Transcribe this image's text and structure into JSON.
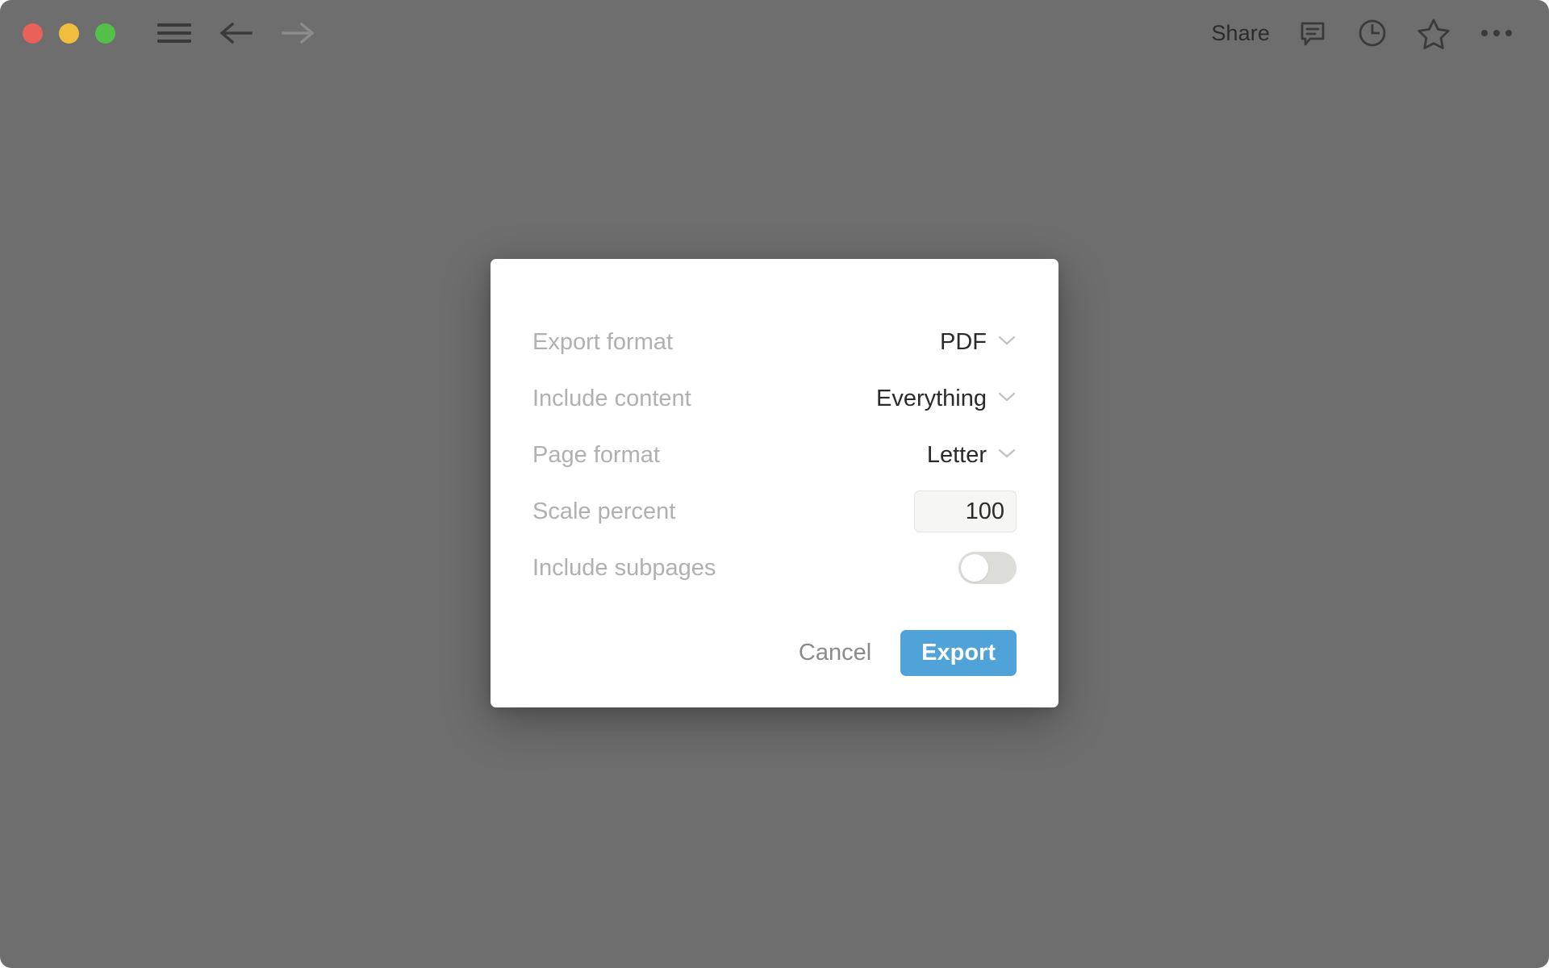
{
  "window": {
    "background_color": "#6e6e6e",
    "corner_radius_px": 14
  },
  "toolbar": {
    "traffic_lights": [
      {
        "name": "close",
        "color": "#ea6159"
      },
      {
        "name": "minimize",
        "color": "#f0bd3d"
      },
      {
        "name": "maximize",
        "color": "#54c04a"
      }
    ],
    "menu_icon": "hamburger-menu-icon",
    "back_icon": "arrow-left-icon",
    "forward_icon": "arrow-right-icon",
    "back_enabled": true,
    "forward_enabled": false,
    "share_label": "Share",
    "right_icons": [
      {
        "name": "comment-icon"
      },
      {
        "name": "history-clock-icon"
      },
      {
        "name": "star-icon"
      },
      {
        "name": "more-options-icon"
      }
    ]
  },
  "dialog": {
    "name": "export-dialog",
    "rows": [
      {
        "label": "Export format",
        "control": "select",
        "value": "PDF",
        "chevron": "chevron-down-icon"
      },
      {
        "label": "Include content",
        "control": "select",
        "value": "Everything",
        "chevron": "chevron-down-icon"
      },
      {
        "label": "Page format",
        "control": "select",
        "value": "Letter",
        "chevron": "chevron-down-icon"
      },
      {
        "label": "Scale percent",
        "control": "number",
        "value": "100"
      },
      {
        "label": "Include subpages",
        "control": "toggle",
        "value": "off"
      }
    ],
    "cancel_label": "Cancel",
    "export_label": "Export",
    "accent_color": "#4fa3d8",
    "label_color": "#b0b0b0",
    "value_color": "#2b2b2b"
  }
}
